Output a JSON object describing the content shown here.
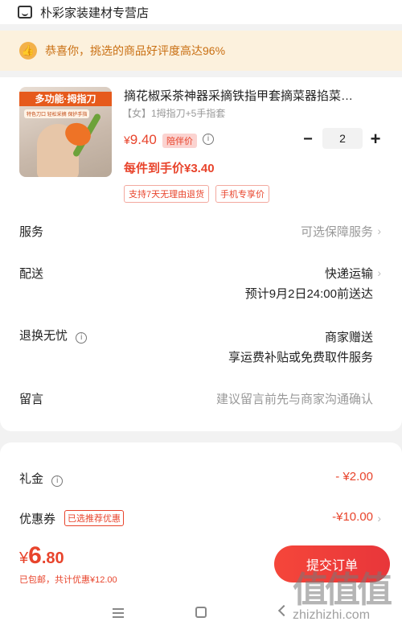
{
  "store": {
    "name": "朴彩家装建材专营店",
    "icon": "store-icon"
  },
  "notice": {
    "icon": "thumbs-up-icon",
    "text": "恭喜你，挑选的商品好评度高达96%"
  },
  "product": {
    "image_banner": "多功能·拇指刀",
    "image_tags": "特色刀口 轻松采摘 保护手指",
    "title": "摘花椒采茶神器采摘铁指甲套摘菜器掐菜…",
    "spec": "【女】1拇指刀+5手指套",
    "price_symbol": "¥",
    "price_value": "9.40",
    "price_tag": "陪伴价",
    "quantity": "2",
    "minus": "−",
    "plus": "+",
    "final_price": "每件到手价¥3.40",
    "tags": [
      "支持7天无理由退货",
      "手机专享价"
    ]
  },
  "rows": {
    "service_label": "服务",
    "service_value": "可选保障服务",
    "delivery_label": "配送",
    "delivery_value": "快递运输",
    "delivery_eta": "预计9月2日24:00前送达",
    "return_label": "退换无忧",
    "return_value1": "商家赠送",
    "return_value2": "享运费补贴或免费取件服务",
    "note_label": "留言",
    "note_placeholder": "建议留言前先与商家沟通确认",
    "chevron": "›",
    "info": "i"
  },
  "discounts": {
    "gift_label": "礼金",
    "gift_value": "- ¥2.00",
    "coupon_label": "优惠券",
    "coupon_tag": "已选推荐优惠",
    "coupon_value": "-¥10.00"
  },
  "checkout": {
    "currency": "¥",
    "total_int": "6",
    "total_dec": ".80",
    "subnote": "已包邮，共计优惠¥12.00",
    "submit_label": "提交订单"
  },
  "watermark": {
    "glyphs": "值值值",
    "url": "zhizhizhi.com"
  },
  "colors": {
    "accent": "#e8442c",
    "notice_bg": "#fcf1dd",
    "notice_text": "#c96f12"
  }
}
